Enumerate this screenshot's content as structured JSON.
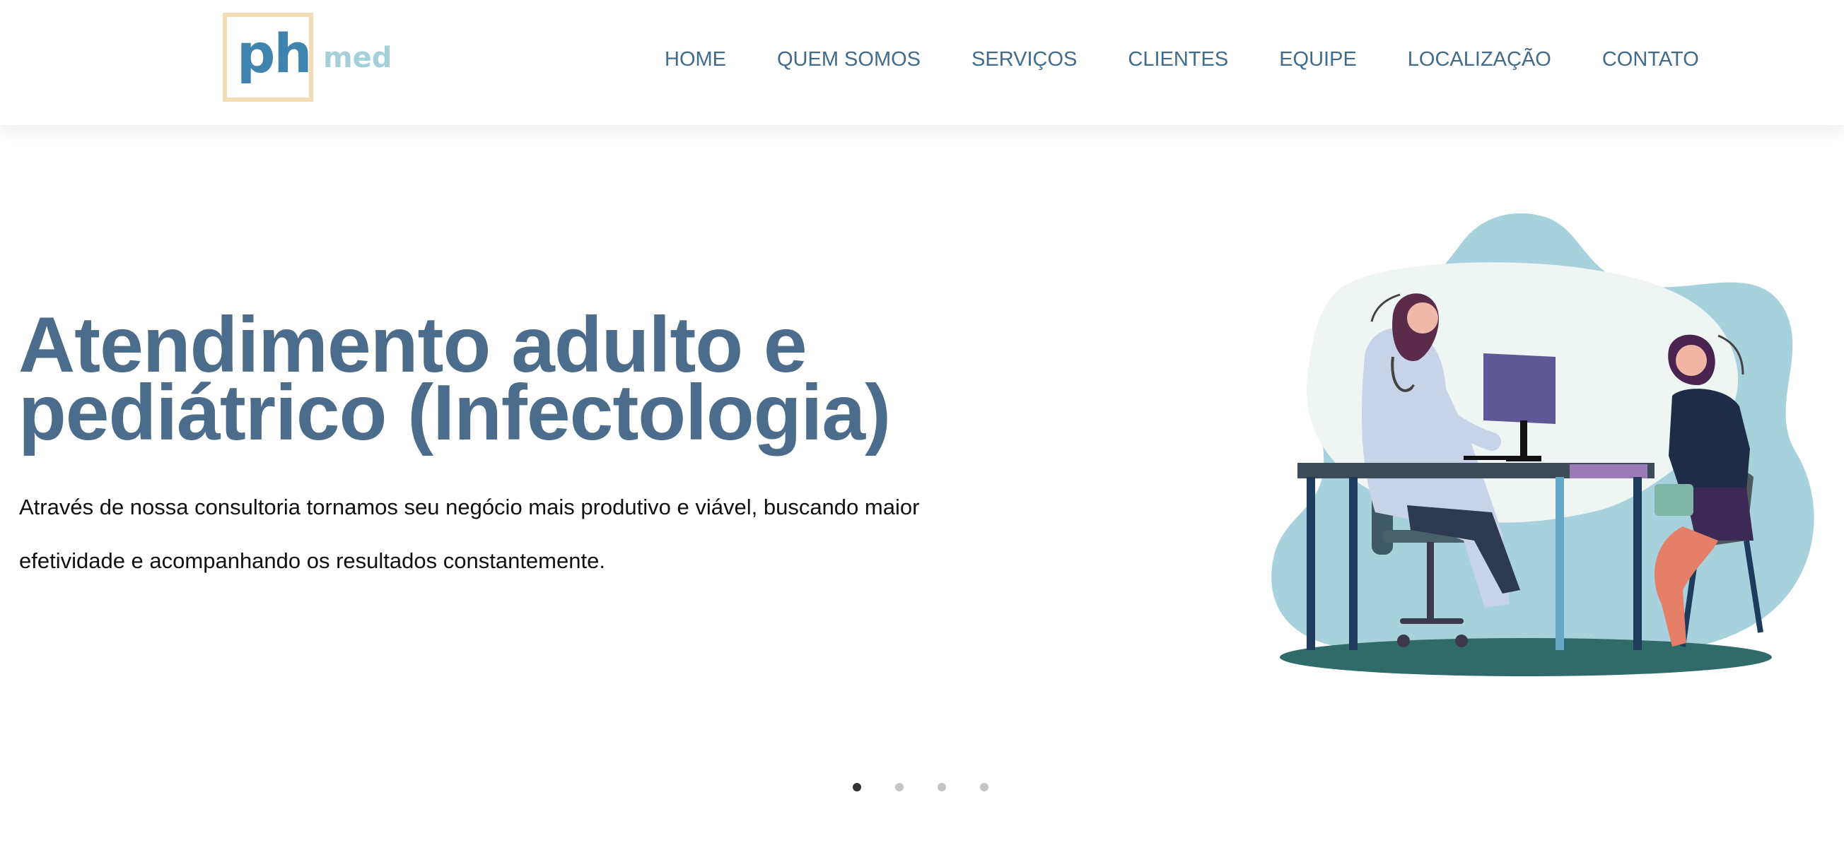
{
  "header": {
    "logo": {
      "ph": "ph",
      "med": "med"
    },
    "nav": [
      {
        "label": "HOME"
      },
      {
        "label": "QUEM SOMOS"
      },
      {
        "label": "SERVIÇOS"
      },
      {
        "label": "CLIENTES"
      },
      {
        "label": "EQUIPE"
      },
      {
        "label": "LOCALIZAÇÃO"
      },
      {
        "label": "CONTATO"
      }
    ]
  },
  "hero": {
    "title": "Atendimento adulto e pediátrico (Infectologia)",
    "text": "Através de nossa consultoria tornamos seu negócio mais produtivo e viável, buscando maior efetividade e acompanhando os resultados constantemente."
  },
  "carousel": {
    "slides": 4,
    "active_index": 0
  },
  "colors": {
    "nav_text": "#3f6b8c",
    "title": "#4b6c8b",
    "logo_blue": "#3f84ae",
    "logo_teal": "#a5d0d9",
    "logo_border": "#f4dcb5"
  },
  "icons": {
    "illustration": "doctor-consultation-illustration"
  }
}
